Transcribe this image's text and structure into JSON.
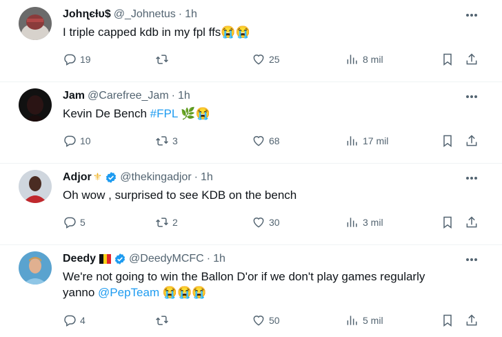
{
  "tweets": [
    {
      "name": "Johɳєƚυ$",
      "handle": "@_Johnetus",
      "dot": "·",
      "time": "1h",
      "text": "I triple capped kdb in my fpl ffs",
      "emoji": "😭😭",
      "replies": "19",
      "retweets": "",
      "likes": "25",
      "views": "8 mil"
    },
    {
      "name": "Jam",
      "handle": "@Carefree_Jam",
      "dot": "·",
      "time": "1h",
      "text": "Kevin De Bench ",
      "hashtag": "#FPL",
      "emoji": "🌿😭",
      "replies": "10",
      "retweets": "3",
      "likes": "68",
      "views": "17 mil"
    },
    {
      "name": "Adjor",
      "name_emoji": "⚜",
      "handle": "@thekingadjor",
      "dot": "·",
      "time": "1h",
      "text": "Oh wow , surprised to see KDB on the bench",
      "replies": "5",
      "retweets": "2",
      "likes": "30",
      "views": "3 mil"
    },
    {
      "name": "Deedy",
      "handle": "@DeedyMCFC",
      "dot": "·",
      "time": "1h",
      "text_line1": "We're not going to win the Ballon D'or if we don't play games regularly",
      "text_line2": "yanno ",
      "mention": "@PepTeam",
      "emoji": " 😭😭😭",
      "replies": "4",
      "retweets": "",
      "likes": "50",
      "views": "5 mil"
    }
  ],
  "colors": {
    "text": "#0f1419",
    "secondary": "#536471",
    "link": "#1d9bf0",
    "verified": "#1d9bf0",
    "divider": "#eff3f4"
  },
  "icons": [
    "reply-icon",
    "retweet-icon",
    "like-icon",
    "views-icon",
    "bookmark-icon",
    "share-icon",
    "more-icon",
    "verified-icon"
  ]
}
